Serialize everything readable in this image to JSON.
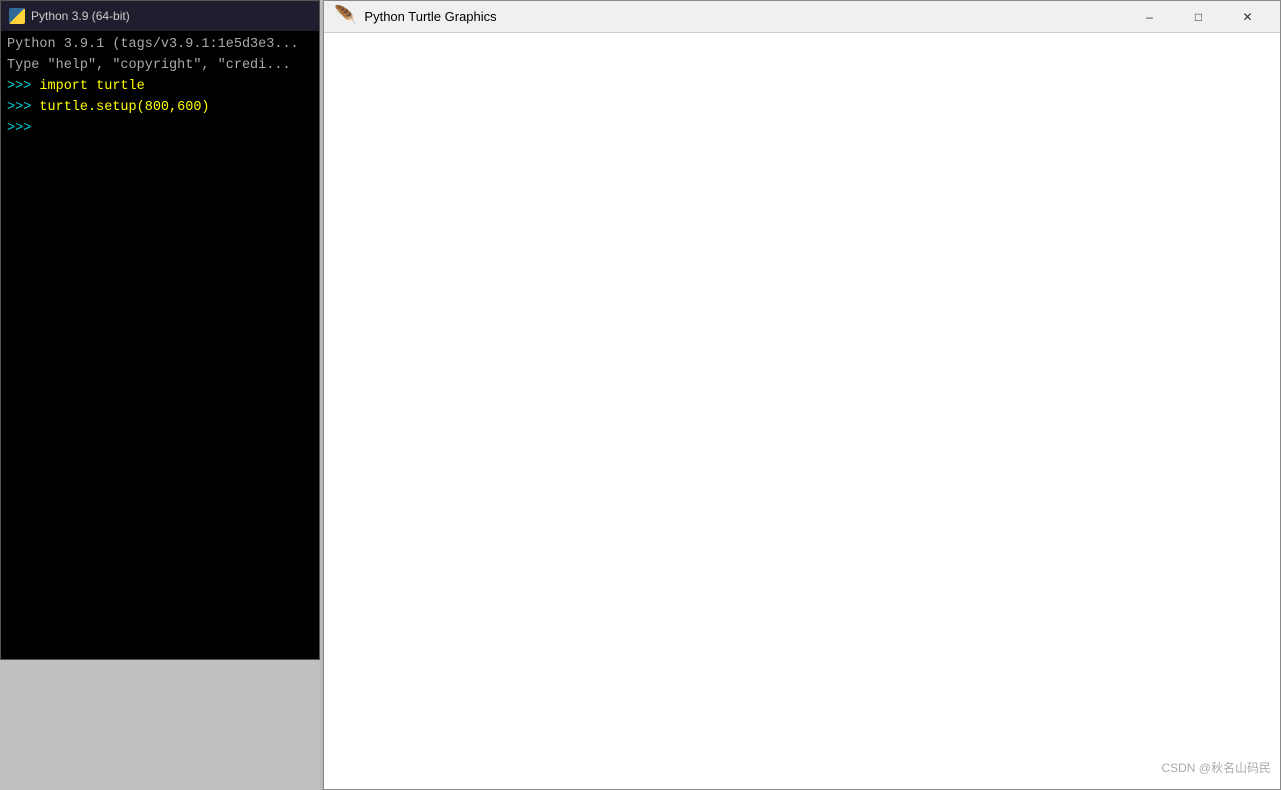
{
  "shell": {
    "titlebar": {
      "title": "Python 3.9 (64-bit)"
    },
    "lines": [
      {
        "type": "gray",
        "text": "Python 3.9.1 (tags/v3.9.1:1e5d3e3..."
      },
      {
        "type": "gray",
        "text": "Type \"help\", \"copyright\", \"credi..."
      },
      {
        "type": "prompt",
        "text": ">>> import turtle"
      },
      {
        "type": "prompt",
        "text": ">>> turtle.setup(800,600)"
      },
      {
        "type": "prompt",
        "text": ">>> "
      }
    ]
  },
  "turtle": {
    "titlebar": {
      "title": "Python Turtle Graphics",
      "minimize_label": "–",
      "maximize_label": "□",
      "close_label": "✕"
    }
  },
  "watermark": {
    "text": "CSDN @秋名山码民"
  }
}
